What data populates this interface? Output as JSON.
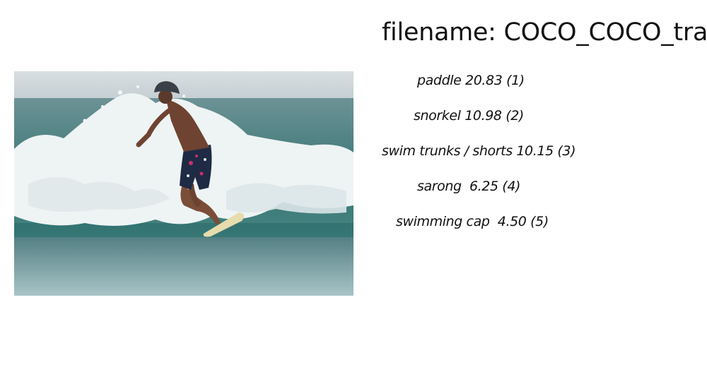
{
  "filename_text": "filename: COCO_COCO_train",
  "predictions": [
    {
      "text": "paddle 20.83 (1)"
    },
    {
      "text": "snorkel 10.98 (2)"
    },
    {
      "text": "swim trunks / shorts 10.15 (3)"
    },
    {
      "text": "sarong  6.25 (4)"
    },
    {
      "text": "swimming cap  4.50 (5)"
    }
  ],
  "colors": {
    "sky": "#c9d3d6",
    "sea": "#5f8e93",
    "foam": "#eef3f4",
    "trunks": "#1f2a44",
    "board": "#e6dcae"
  }
}
